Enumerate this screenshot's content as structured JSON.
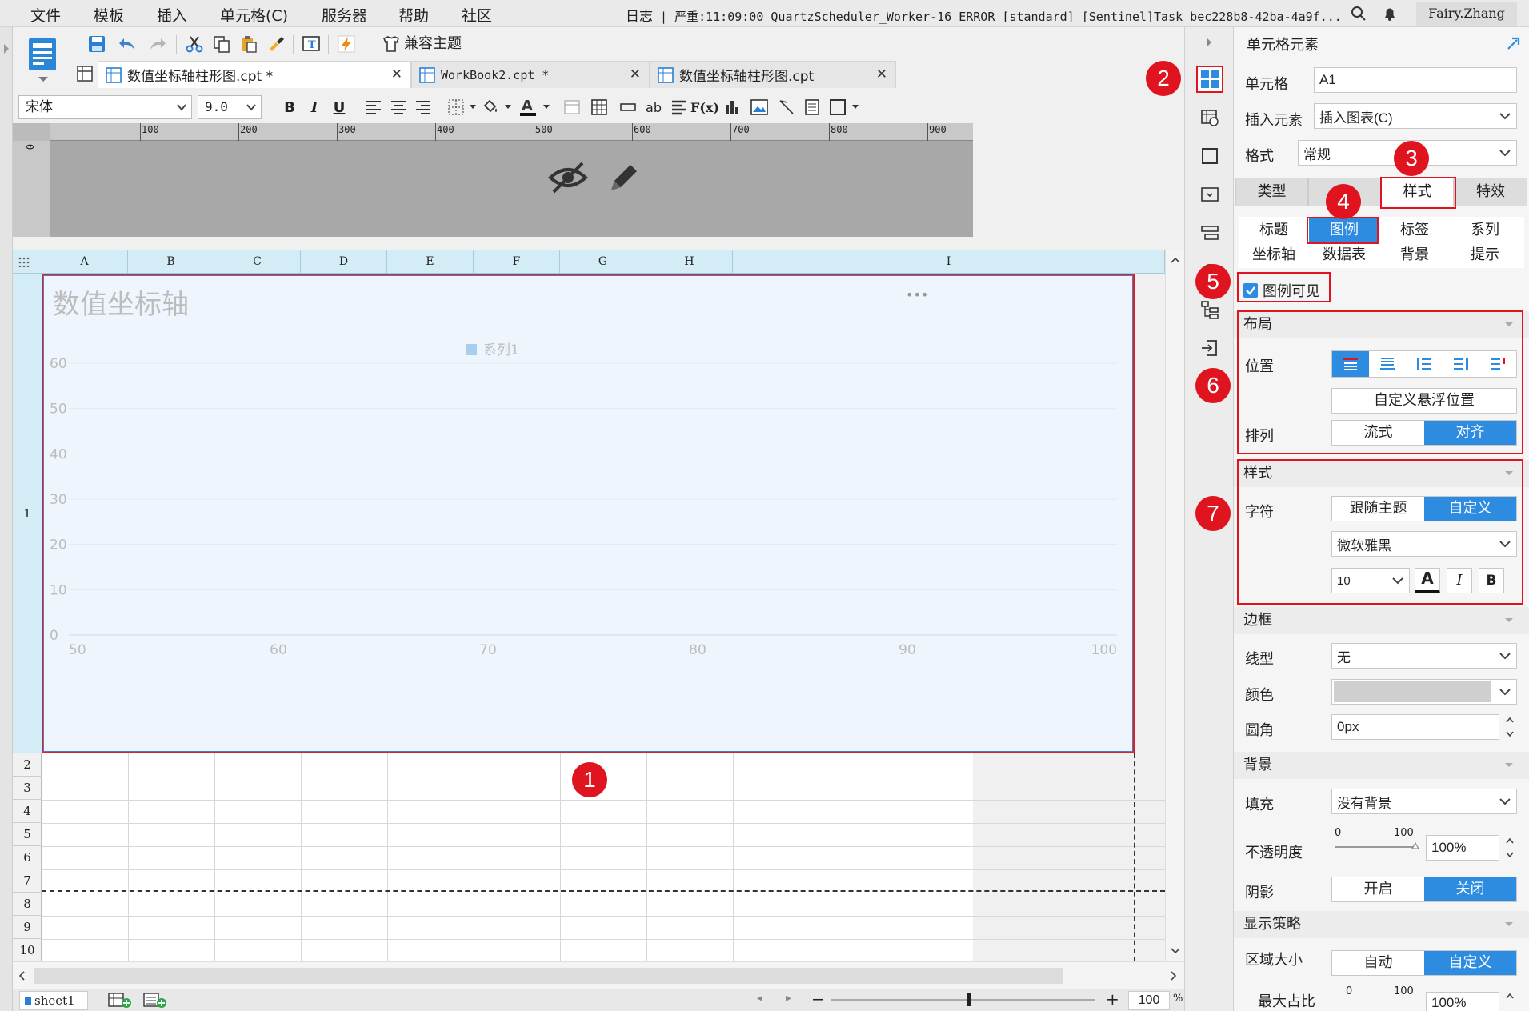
{
  "menubar": {
    "items": [
      "文件",
      "模板",
      "插入",
      "单元格(C)",
      "服务器",
      "帮助",
      "社区"
    ],
    "log_label": "日志",
    "log_text": "| 严重:11:09:00 QuartzScheduler_Worker-16 ERROR [standard] [Sentinel]Task bec228b8-42ba-4a9f...",
    "user": "Fairy.Zhang"
  },
  "toolbar": {
    "compat_theme": "兼容主题",
    "font": "宋体",
    "font_size": "9.0",
    "bold": "B",
    "italic": "I",
    "underline": "U",
    "text_ab": "ab",
    "formula": "F(x)"
  },
  "tabs": [
    {
      "label": "数值坐标轴柱形图.cpt *",
      "active": true
    },
    {
      "label": "WorkBook2.cpt *",
      "active": false
    },
    {
      "label": "数值坐标轴柱形图.cpt",
      "active": false
    }
  ],
  "ruler": {
    "labels": [
      "0",
      "100",
      "200",
      "300",
      "400",
      "500",
      "600",
      "700",
      "800",
      "900"
    ],
    "vlabel": "0"
  },
  "sheet": {
    "columns": [
      "A",
      "B",
      "C",
      "D",
      "E",
      "F",
      "G",
      "H",
      "I"
    ],
    "rows": [
      "1",
      "2",
      "3",
      "4",
      "5",
      "6",
      "7",
      "8",
      "9",
      "10"
    ],
    "tab": "sheet1",
    "zoom": "100",
    "zoom_unit": "%"
  },
  "chart_data": {
    "type": "bar",
    "title": "数值坐标轴",
    "legend": [
      "系列1"
    ],
    "legend_position": "top",
    "menu_dots": "•••",
    "xlim": [
      50,
      100
    ],
    "ylim": [
      0,
      60
    ],
    "xticks": [
      "50",
      "60",
      "70",
      "80",
      "90",
      "100"
    ],
    "yticks": [
      "0",
      "10",
      "20",
      "30",
      "40",
      "50",
      "60"
    ],
    "series": [],
    "grid": true,
    "colors": {
      "legend": "#a9cdf0",
      "text": "#bcbcbc",
      "grid": "#e3e9f0"
    }
  },
  "panel": {
    "title": "单元格元素",
    "cell_label": "单元格",
    "cell_value": "A1",
    "insert_label": "插入元素",
    "insert_value": "插入图表(C)",
    "format_label": "格式",
    "format_value": "常规",
    "main_tabs": [
      "类型",
      "",
      "样式",
      "特效"
    ],
    "sub_tabs": [
      "标题",
      "图例",
      "标签",
      "系列",
      "坐标轴",
      "数据表",
      "背景",
      "提示"
    ],
    "legend_visible": "图例可见",
    "layout": {
      "header": "布局",
      "position_label": "位置",
      "custom_float": "自定义悬浮位置",
      "arrange_label": "排列",
      "arrange_options": [
        "流式",
        "对齐"
      ]
    },
    "style": {
      "header": "样式",
      "char_label": "字符",
      "char_options": [
        "跟随主题",
        "自定义"
      ],
      "font": "微软雅黑",
      "size": "10",
      "font_btns": [
        "A",
        "I",
        "B"
      ]
    },
    "border": {
      "header": "边框",
      "linetype_label": "线型",
      "linetype_value": "无",
      "color_label": "颜色",
      "radius_label": "圆角",
      "radius_value": "0px"
    },
    "background": {
      "header": "背景",
      "fill_label": "填充",
      "fill_value": "没有背景",
      "opacity_label": "不透明度",
      "slider_min": "0",
      "slider_max": "100",
      "opacity_value": "100%",
      "shadow_label": "阴影",
      "shadow_options": [
        "开启",
        "关闭"
      ]
    },
    "display": {
      "header": "显示策略",
      "area_label": "区域大小",
      "area_options": [
        "自动",
        "自定义"
      ],
      "maxratio_label": "最大占比",
      "slider_min": "0",
      "slider_max": "100",
      "maxratio_value": "100%"
    }
  },
  "badges": [
    "1",
    "2",
    "3",
    "4",
    "5",
    "6",
    "7"
  ],
  "colors": {
    "accent": "#2e8ce0",
    "highlight": "#e0141e"
  }
}
